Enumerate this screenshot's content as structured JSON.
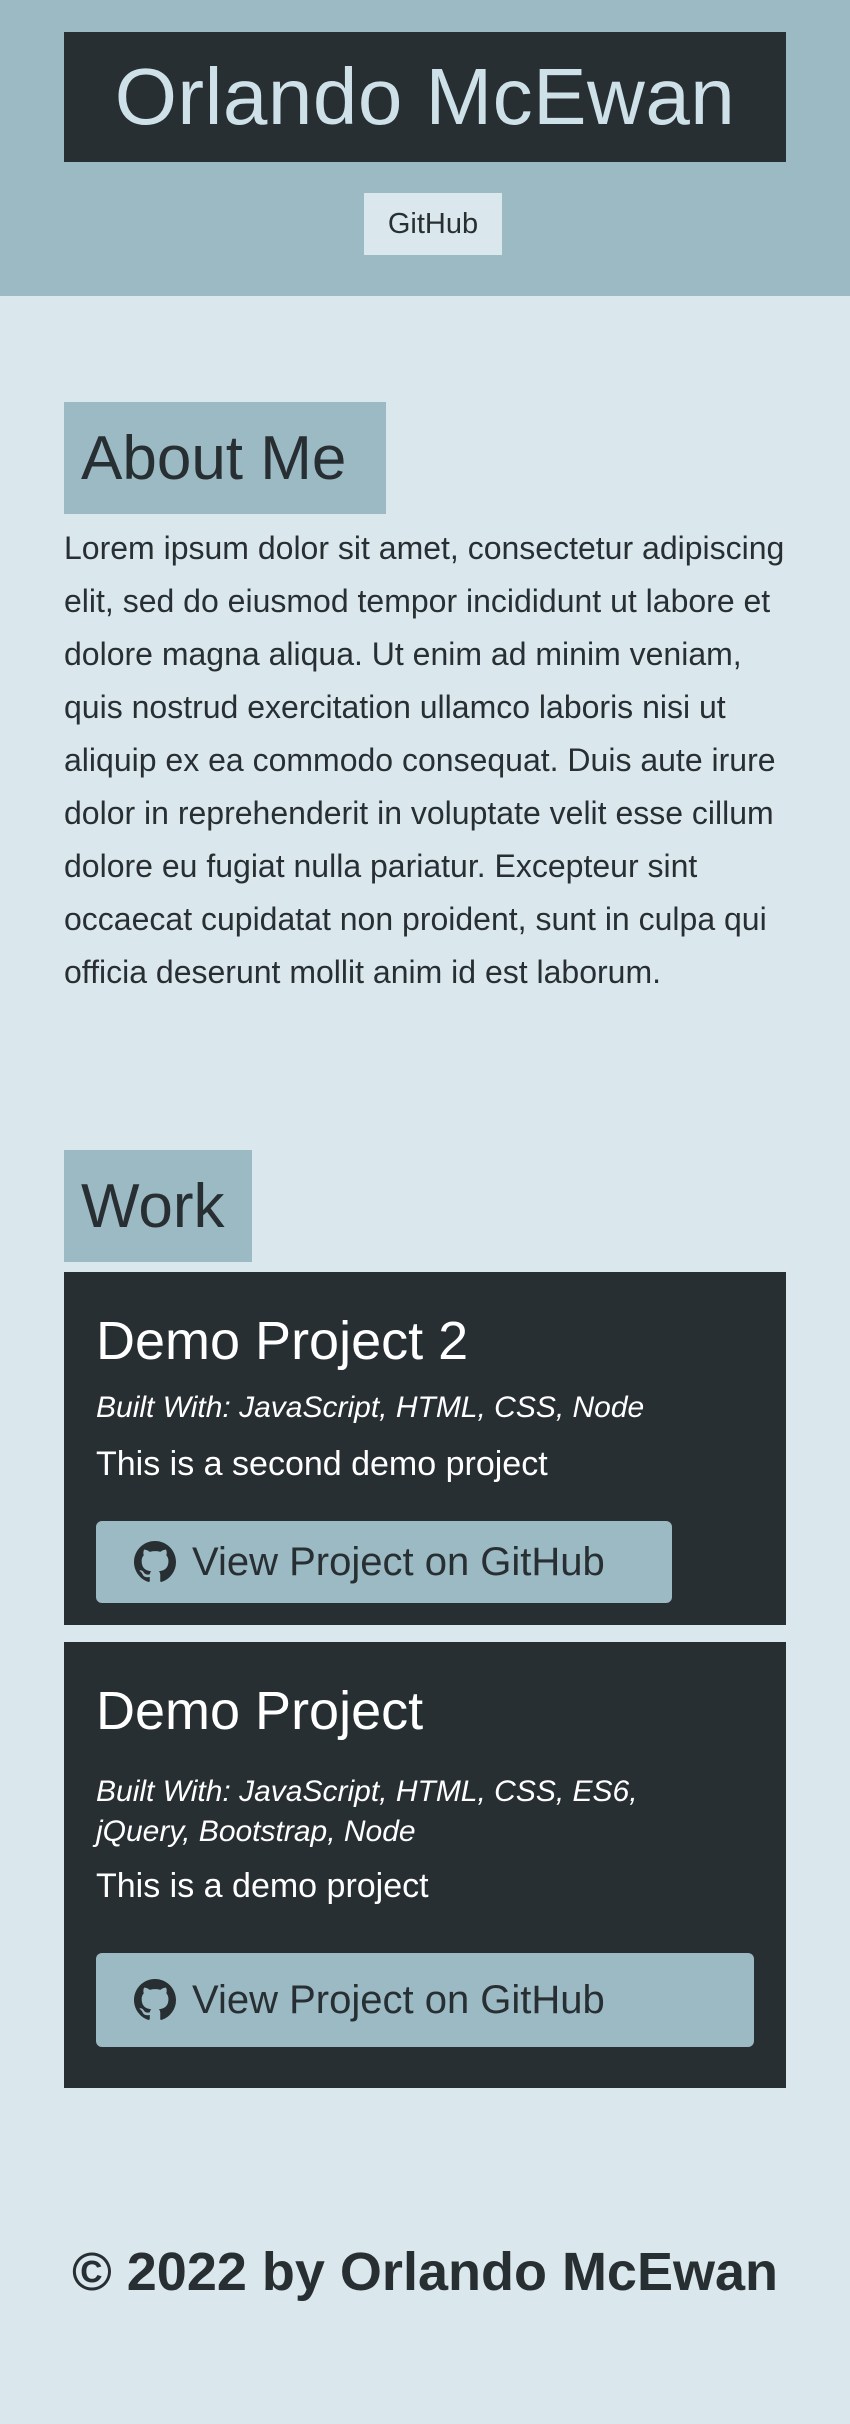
{
  "header": {
    "name": "Orlando McEwan",
    "github_link": "GitHub"
  },
  "about": {
    "heading": "About Me",
    "text": "Lorem ipsum dolor sit amet, consectetur adipiscing elit, sed do eiusmod tempor incididunt ut labore et dolore magna aliqua. Ut enim ad minim veniam, quis nostrud exercitation ullamco laboris nisi ut aliquip ex ea commodo consequat. Duis aute irure dolor in reprehenderit in voluptate velit esse cillum dolore eu fugiat nulla pariatur. Excepteur sint occaecat cupidatat non proident, sunt in culpa qui officia deserunt mollit anim id est laborum."
  },
  "work": {
    "heading": "Work",
    "projects": [
      {
        "title": "Demo Project 2",
        "built_with": "Built With: JavaScript, HTML, CSS, Node",
        "description": "This is a second demo project",
        "button_label": "View Project on GitHub",
        "button_icon": "github-icon"
      },
      {
        "title": "Demo Project",
        "built_with": "Built With: JavaScript, HTML, CSS, ES6, jQuery, Bootstrap, Node",
        "description": "This is a demo project",
        "button_label": "View Project on GitHub",
        "button_icon": "github-icon"
      }
    ]
  },
  "footer": {
    "copyright": "© 2022 by Orlando McEwan"
  },
  "colors": {
    "page_background": "#dae7ed",
    "header_background": "#9bbac4",
    "dark": "#282f33",
    "accent": "#9bbac4"
  }
}
